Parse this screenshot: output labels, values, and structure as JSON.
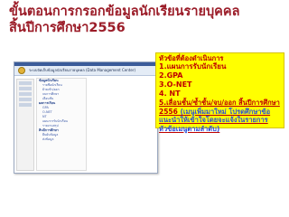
{
  "slide": {
    "title_line1": "ขั้นตอนการกรอกข้อมูลนักเรียนรายบุคคล",
    "title_line2": "สิ้นปีการศึกษา2556"
  },
  "screenshot": {
    "header_text": "ระบบจัดเก็บข้อมูลนักเรียนรายบุคคล (Data Management Center)",
    "menu_groups": [
      {
        "label": "ข้อมูลนักเรียน",
        "items": [
          "รายชื่อนักเรียน",
          "ย้ายเข้า/ออก",
          "จบการศึกษา",
          "เลื่อนชั้น"
        ]
      },
      {
        "label": "ผลการเรียน",
        "items": [
          "GPA",
          "O-NET",
          "NT",
          "แผนการรับนักเรียน",
          "รายงานสรุป"
        ]
      },
      {
        "label": "สิ้นปีการศึกษา",
        "items": [
          "ยืนยันข้อมูล",
          "ส่งข้อมูล"
        ]
      }
    ]
  },
  "callout": {
    "heading": "หัวข้อที่ต้องดำเนินการ",
    "items": [
      "1.แผนการรับนักเรียน",
      "2.GPA",
      "3.O-NET",
      "4. NT",
      "5.เลื่อนชั้น/ซ้ำชั้น/จบ/ออก สิ้นปีการศึกษา 2556 "
    ],
    "item5_suffix": "(เมนูเพิ่มมาใหม่ โปรดศึกษาข้อแนะนำให้เข้าใจโดยจะแจ้งในรายการหัวข้อเมนูตามลำดับ)"
  },
  "colors": {
    "title": "#9b1c28",
    "callout_bg": "#ffff00",
    "callout_text": "#c00000",
    "callout_note": "#2b4fd6",
    "screenshot_bar": "#3b5c9a"
  }
}
